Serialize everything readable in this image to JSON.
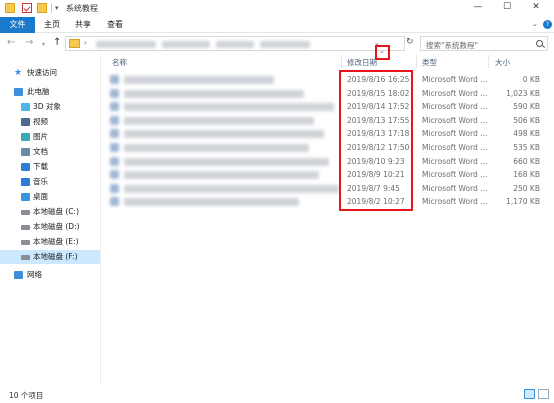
{
  "window": {
    "title": "系统教程",
    "minimize": "—",
    "maximize": "☐",
    "close": "✕"
  },
  "ribbon": {
    "tabs": [
      "文件",
      "主页",
      "共享",
      "查看"
    ]
  },
  "search": {
    "placeholder": "搜索\"系统教程\""
  },
  "sidebar": {
    "items": [
      {
        "label": "快速访问",
        "icon": "star-icon"
      },
      {
        "label": "此电脑",
        "icon": "pc-icon"
      },
      {
        "label": "3D 对象",
        "icon": "3d-objects-icon"
      },
      {
        "label": "视频",
        "icon": "video-icon"
      },
      {
        "label": "图片",
        "icon": "pictures-icon"
      },
      {
        "label": "文档",
        "icon": "documents-icon"
      },
      {
        "label": "下载",
        "icon": "download-icon"
      },
      {
        "label": "音乐",
        "icon": "music-icon"
      },
      {
        "label": "桌面",
        "icon": "desktop-icon"
      },
      {
        "label": "本地磁盘 (C:)",
        "icon": "drive-icon"
      },
      {
        "label": "本地磁盘 (D:)",
        "icon": "drive-icon"
      },
      {
        "label": "本地磁盘 (E:)",
        "icon": "drive-icon"
      },
      {
        "label": "本地磁盘 (F:)",
        "icon": "drive-icon",
        "selected": true
      },
      {
        "label": "网络",
        "icon": "network-icon"
      }
    ]
  },
  "columns": {
    "name": "名称",
    "date": "修改日期",
    "type": "类型",
    "size": "大小"
  },
  "files": [
    {
      "date": "2019/8/16 16:25",
      "type": "Microsoft Word ...",
      "size": "0 KB"
    },
    {
      "date": "2019/8/15 18:02",
      "type": "Microsoft Word ...",
      "size": "1,023 KB"
    },
    {
      "date": "2019/8/14 17:52",
      "type": "Microsoft Word ...",
      "size": "590 KB"
    },
    {
      "date": "2019/8/13 17:55",
      "type": "Microsoft Word ...",
      "size": "506 KB"
    },
    {
      "date": "2019/8/13 17:18",
      "type": "Microsoft Word ...",
      "size": "498 KB"
    },
    {
      "date": "2019/8/12 17:50",
      "type": "Microsoft Word ...",
      "size": "535 KB"
    },
    {
      "date": "2019/8/10 9:23",
      "type": "Microsoft Word ...",
      "size": "660 KB"
    },
    {
      "date": "2019/8/9 10:21",
      "type": "Microsoft Word ...",
      "size": "168 KB"
    },
    {
      "date": "2019/8/7 9:45",
      "type": "Microsoft Word ...",
      "size": "250 KB"
    },
    {
      "date": "2019/8/2 10:27",
      "type": "Microsoft Word ...",
      "size": "1,170 KB"
    }
  ],
  "status": {
    "count": "10 个项目"
  },
  "colors": {
    "accent": "#1979ca",
    "highlight": "#e8141b",
    "selection": "#cce8ff"
  }
}
